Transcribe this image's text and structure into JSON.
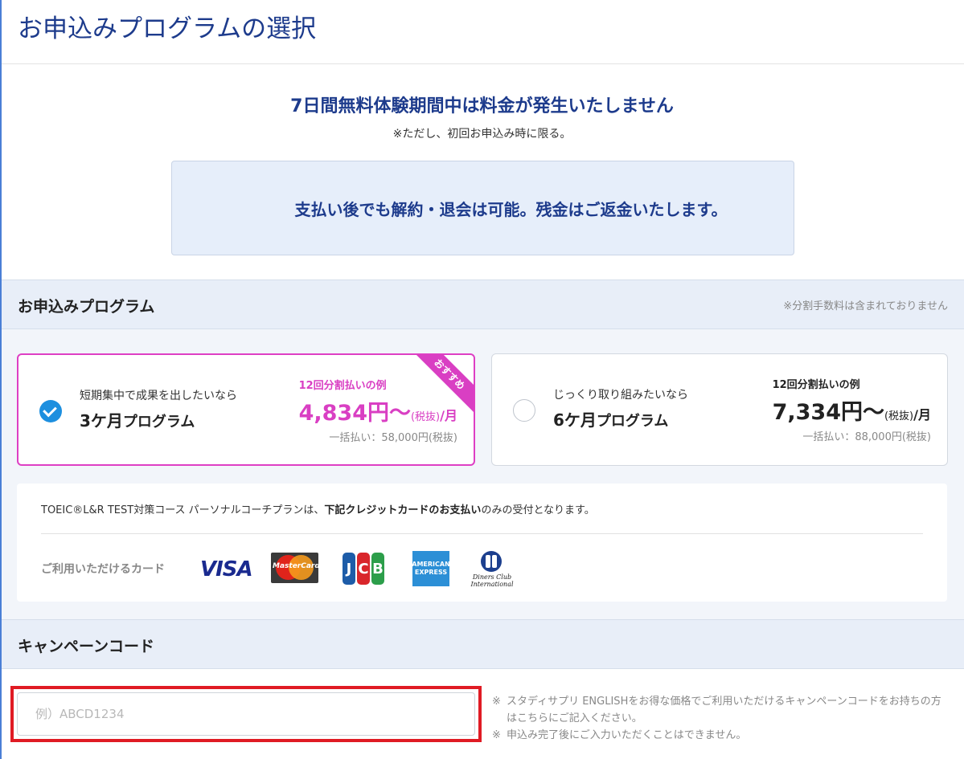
{
  "page": {
    "title": "お申込みプログラムの選択"
  },
  "hero": {
    "title": "7日間無料体験期間中は料金が発生いたしません",
    "note": "※ただし、初回お申込み時に限る。",
    "refund": "支払い後でも解約・退会は可能。残金はご返金いたします。"
  },
  "program_section": {
    "title": "お申込みプログラム",
    "note": "※分割手数料は含まれておりません",
    "plans": [
      {
        "subtitle": "短期集中で成果を出したいなら",
        "name_num": "3ケ月",
        "name_suffix": "プログラム",
        "badge": "おすすめ",
        "price_label": "12回分割払いの例",
        "price": "4,834円〜",
        "price_tax": "(税抜)",
        "price_unit": "/月",
        "lump_sum": "一括払い：58,000円(税抜)",
        "selected": true
      },
      {
        "subtitle": "じっくり取り組みたいなら",
        "name_num": "6ケ月",
        "name_suffix": "プログラム",
        "price_label": "12回分割払いの例",
        "price": "7,334円〜",
        "price_tax": "(税抜)",
        "price_unit": "/月",
        "lump_sum": "一括払い：88,000円(税抜)",
        "selected": false
      }
    ]
  },
  "payment_info": {
    "text_before": "TOEIC®L&R TEST対策コース パーソナルコーチプランは、",
    "text_bold": "下記クレジットカードのお支払い",
    "text_after": "のみの受付となります。",
    "cards_label": "ご利用いただけるカード",
    "cards": {
      "visa": "VISA",
      "mastercard": "MasterCard",
      "jcb": [
        "J",
        "C",
        "B"
      ],
      "amex": "AMERICAN EXPRESS",
      "diners": "Diners Club International"
    }
  },
  "campaign": {
    "title": "キャンペーンコード",
    "placeholder": "例）ABCD1234",
    "value": "",
    "notes": [
      "スタディサプリ ENGLISHをお得な価格でご利用いただけるキャンペーンコードをお持ちの方はこちらにご記入ください。",
      "申込み完了後にご入力いただくことはできません。"
    ],
    "note_mark": "※"
  },
  "colors": {
    "brand_blue": "#1d3b8c",
    "accent_pink": "#d93fc3",
    "check_blue": "#1d8fdf",
    "highlight_red": "#e01b24"
  }
}
